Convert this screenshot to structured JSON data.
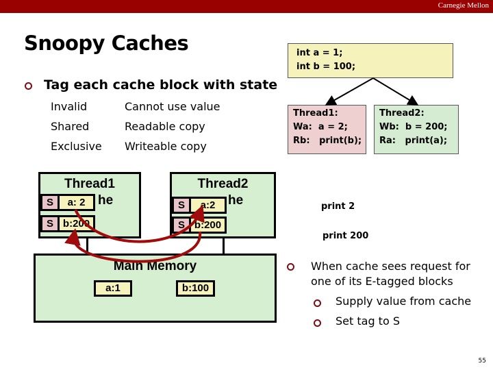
{
  "header": {
    "brand": "Carnegie Mellon"
  },
  "slide": {
    "title": "Snoopy Caches",
    "bullet": "Tag each cache block with state",
    "states": [
      {
        "name": "Invalid",
        "desc": "Cannot use value"
      },
      {
        "name": "Shared",
        "desc": "Readable copy"
      },
      {
        "name": "Exclusive",
        "desc": "Writeable copy"
      }
    ],
    "page_number": "55"
  },
  "code": {
    "init": [
      "int a = 1;",
      "int b = 100;"
    ],
    "thread1": [
      "Thread1:",
      "Wa:  a = 2;",
      "Rb:   print(b);"
    ],
    "thread2": [
      "Thread2:",
      "Wb:  b = 200;",
      "Ra:   print(a);"
    ]
  },
  "outputs": [
    "print 2",
    "print 200"
  ],
  "diagram": {
    "cache1": {
      "title": "Thread1",
      "subtitle_partial": "he",
      "entries": [
        {
          "state": "S",
          "value": "a: 2"
        },
        {
          "state": "S",
          "value": "b:200"
        }
      ]
    },
    "cache2": {
      "title": "Thread2",
      "subtitle_partial": "he",
      "entries": [
        {
          "state": "S",
          "value": "a:2"
        },
        {
          "state": "S",
          "value": "b:200"
        }
      ]
    },
    "memory": {
      "title": "Main Memory",
      "cells": [
        "a:1",
        "b:100"
      ]
    },
    "arrow_color": "#a00c0c"
  },
  "notes": {
    "main": [
      "When cache sees request for",
      "one of its E-tagged blocks"
    ],
    "sub": [
      "Supply value from cache",
      "Set tag to S"
    ]
  }
}
